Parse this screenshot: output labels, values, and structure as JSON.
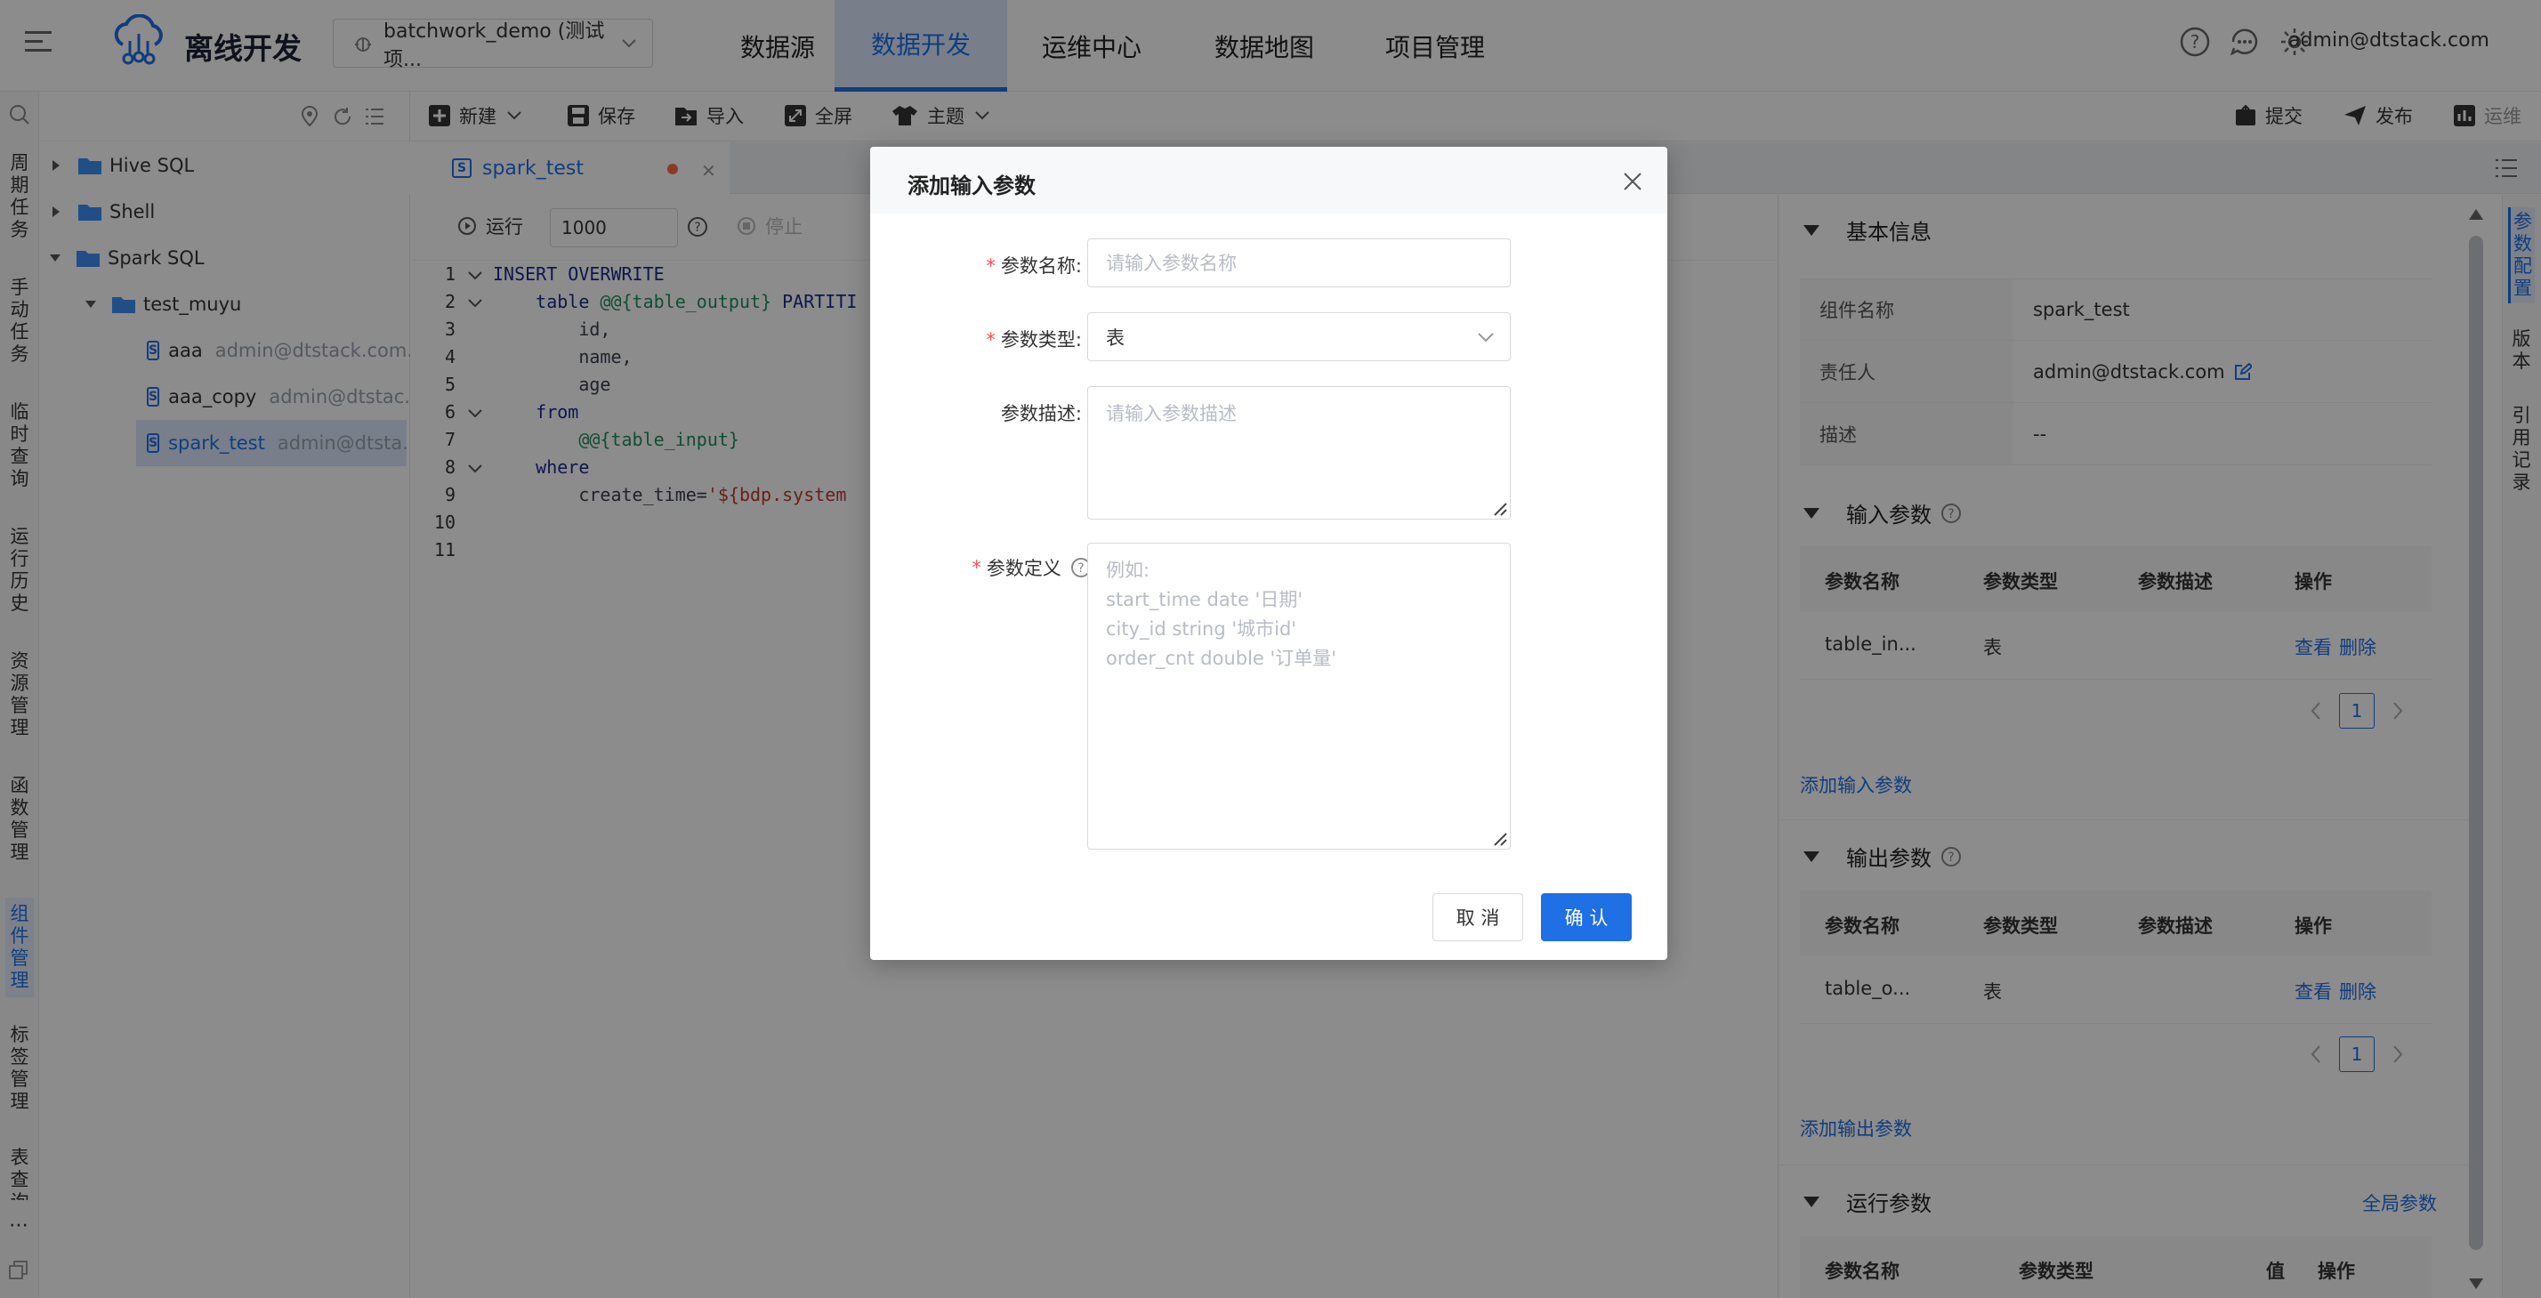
{
  "app": {
    "title": "离线开发",
    "project": "batchwork_demo (测试项...",
    "user": "admin@dtstack.com"
  },
  "nav": [
    "数据源",
    "数据开发",
    "运维中心",
    "数据地图",
    "项目管理"
  ],
  "left_rail": [
    "周期任务",
    "手动任务",
    "临时查询",
    "运行历史",
    "资源管理",
    "函数管理",
    "组件管理",
    "标签管理",
    "表查询"
  ],
  "tree": {
    "nodes": [
      {
        "label": "Hive SQL"
      },
      {
        "label": "Shell"
      },
      {
        "label": "Spark SQL"
      },
      {
        "label": "test_muyu"
      }
    ],
    "files": [
      {
        "name": "aaa",
        "meta": "admin@dtstack.com..."
      },
      {
        "name": "aaa_copy",
        "meta": "admin@dtstac..."
      },
      {
        "name": "spark_test",
        "meta": "admin@dtsta..."
      }
    ],
    "file_badge": "S"
  },
  "toolbar": {
    "new": "新建",
    "save": "保存",
    "import": "导入",
    "fullscreen": "全屏",
    "theme": "主题",
    "submit": "提交",
    "publish": "发布",
    "ops": "运维"
  },
  "editor": {
    "tab": "spark_test",
    "run": "运行",
    "limit": "1000",
    "stop": "停止",
    "lines": [
      [
        {
          "c": "kw",
          "t": "INSERT OVERWRITE"
        }
      ],
      [
        {
          "c": "kw",
          "t": "    table "
        },
        {
          "c": "var",
          "t": "@@{table_output}"
        },
        {
          "c": "kw",
          "t": " PARTITI"
        }
      ],
      [
        {
          "c": "",
          "t": "        id,"
        }
      ],
      [
        {
          "c": "",
          "t": "        name,"
        }
      ],
      [
        {
          "c": "",
          "t": "        age"
        }
      ],
      [
        {
          "c": "kw",
          "t": "    from"
        }
      ],
      [
        {
          "c": "var",
          "t": "        @@{table_input}"
        }
      ],
      [
        {
          "c": "kw",
          "t": "    where"
        }
      ],
      [
        {
          "c": "",
          "t": "        create_time="
        },
        {
          "c": "str",
          "t": "'${bdp.system"
        }
      ],
      [],
      []
    ]
  },
  "right_panel": {
    "basic": {
      "title": "基本信息",
      "rows": [
        {
          "k": "组件名称",
          "v": "spark_test"
        },
        {
          "k": "责任人",
          "v": "admin@dtstack.com"
        },
        {
          "k": "描述",
          "v": "--"
        }
      ]
    },
    "input": {
      "title": "输入参数",
      "cols": [
        "参数名称",
        "参数类型",
        "参数描述",
        "操作"
      ],
      "row": {
        "name": "table_in...",
        "type": "表",
        "view": "查看",
        "del": "删除"
      },
      "page": "1",
      "add": "添加输入参数"
    },
    "output": {
      "title": "输出参数",
      "cols": [
        "参数名称",
        "参数类型",
        "参数描述",
        "操作"
      ],
      "row": {
        "name": "table_o...",
        "type": "表",
        "view": "查看",
        "del": "删除"
      },
      "page": "1",
      "add": "添加输出参数"
    },
    "run": {
      "title": "运行参数",
      "global": "全局参数",
      "cols": [
        "参数名称",
        "参数类型",
        "值",
        "操作"
      ]
    }
  },
  "right_rail": [
    "参数配置",
    "版本",
    "引用记录"
  ],
  "modal": {
    "title": "添加输入参数",
    "name_label": "参数名称:",
    "name_placeholder": "请输入参数名称",
    "type_label": "参数类型:",
    "type_value": "表",
    "desc_label": "参数描述:",
    "desc_placeholder": "请输入参数描述",
    "def_label": "参数定义",
    "def_placeholder": "例如:\nstart_time date '日期'\ncity_id string '城市id'\norder_cnt double '订单量'",
    "cancel": "取 消",
    "confirm": "确 认"
  }
}
